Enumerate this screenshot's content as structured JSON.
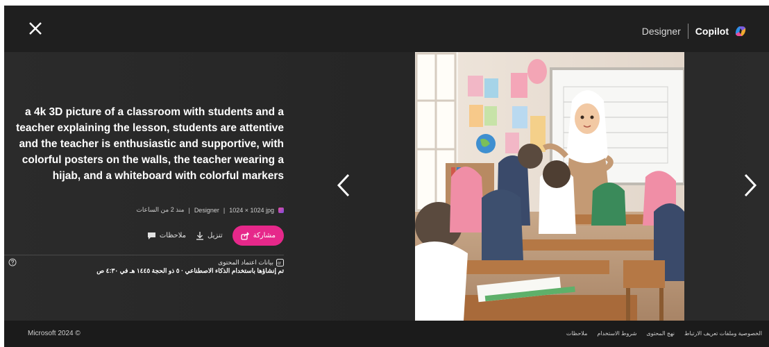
{
  "header": {
    "designer_label": "Designer",
    "copilot_label": "Copilot"
  },
  "prompt": {
    "text": "a 4k 3D picture of a classroom with students and a teacher explaining the lesson, students are attentive and the teacher is enthusiastic and supportive, with colorful posters on the walls, the teacher wearing a hijab, and a whiteboard with colorful markers"
  },
  "meta": {
    "file": "1024 × 1024 jpg",
    "separator": "|",
    "source": "Designer",
    "time": "منذ 2 من الساعات"
  },
  "actions": {
    "share_label": "مشاركة",
    "download_label": "تنزيل",
    "feedback_label": "ملاحظات"
  },
  "credentials": {
    "title": "بيانات اعتماد المحتوى",
    "detail": "تم إنشاؤها باستخدام الذكاء الاصطناعي · ٥ ذو الحجة ١٤٤٥ هـ في ٤:٣٠ ص"
  },
  "footer": {
    "copyright": "Microsoft 2024 ©",
    "links": [
      "الخصوصية وملفات تعريف الارتباط",
      "نهج المحتوى",
      "شروط الاستخدام",
      "ملاحظات"
    ]
  },
  "colors": {
    "accent": "#e6288a",
    "background": "#2a2a2a",
    "topbar": "#1f1f1f",
    "footer": "#1b1b1b"
  }
}
